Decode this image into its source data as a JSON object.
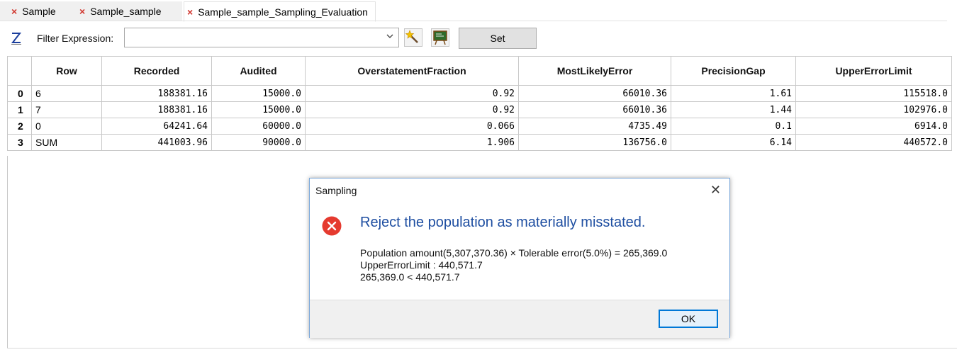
{
  "tabs": [
    {
      "label": "Sample",
      "close": "×"
    },
    {
      "label": "Sample_sample",
      "close": "×"
    },
    {
      "label": "Sample_sample_Sampling_Evaluation",
      "close": "×"
    }
  ],
  "filter": {
    "label": "Filter Expression:",
    "value": "",
    "set_label": "Set"
  },
  "icons": {
    "z": "z-sort-icon",
    "wand": "magic-wand-icon",
    "board": "expression-board-icon",
    "dropdown": "chevron-down-icon"
  },
  "table": {
    "columns": [
      "",
      "Row",
      "Recorded",
      "Audited",
      "OverstatementFraction",
      "MostLikelyError",
      "PrecisionGap",
      "UpperErrorLimit"
    ],
    "rows": [
      [
        "0",
        "6",
        "188381.16",
        "15000.0",
        "0.92",
        "66010.36",
        "1.61",
        "115518.0"
      ],
      [
        "1",
        "7",
        "188381.16",
        "15000.0",
        "0.92",
        "66010.36",
        "1.44",
        "102976.0"
      ],
      [
        "2",
        "0",
        "64241.64",
        "60000.0",
        "0.066",
        "4735.49",
        "0.1",
        "6914.0"
      ],
      [
        "3",
        "SUM",
        "441003.96",
        "90000.0",
        "1.906",
        "136756.0",
        "6.14",
        "440572.0"
      ]
    ]
  },
  "dialog": {
    "title": "Sampling",
    "close": "✕",
    "message": "Reject the population as materially misstated.",
    "detail_lines": [
      "Population amount(5,307,370.36) × Tolerable error(5.0%) = 265,369.0",
      "UpperErrorLimit : 440,571.7",
      "265,369.0 < 440,571.7"
    ],
    "ok_label": "OK",
    "error_color": "#e53a2f",
    "message_color": "#1e4ea1"
  }
}
